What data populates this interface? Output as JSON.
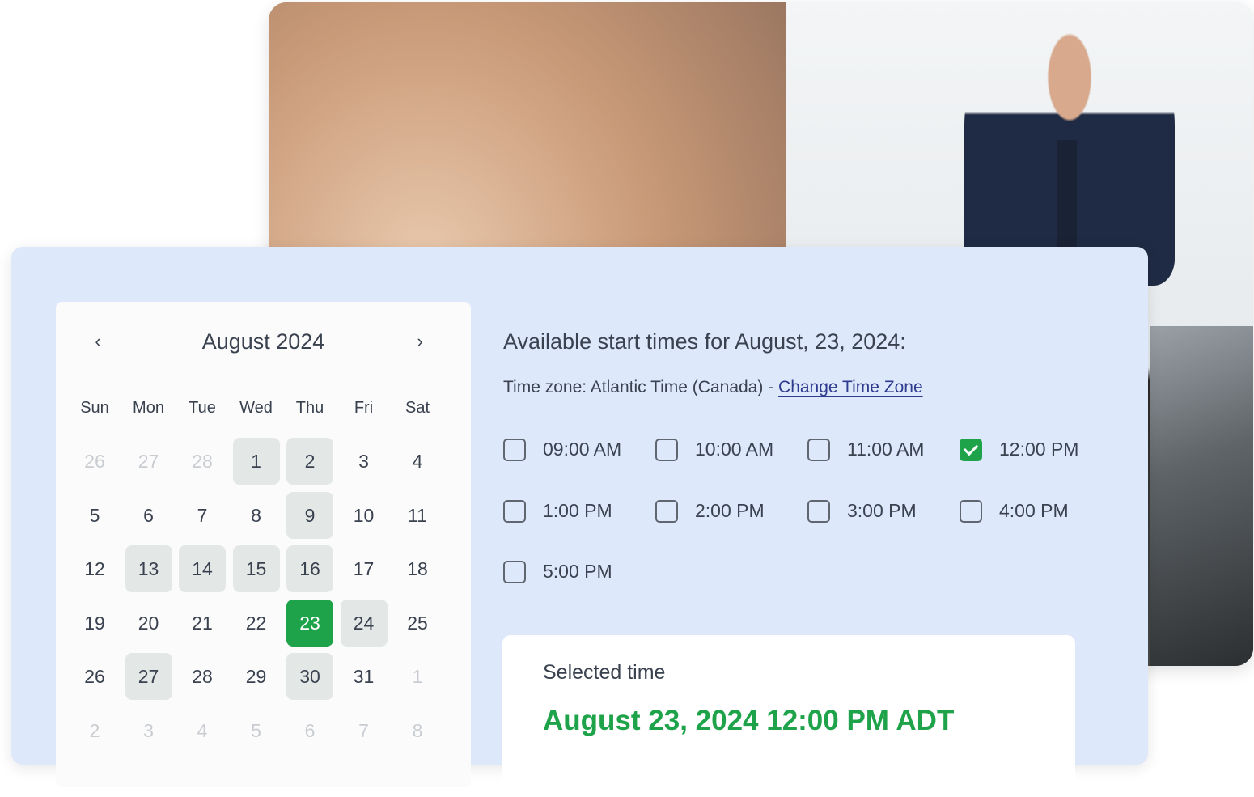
{
  "calendar": {
    "month_title": "August 2024",
    "prev_label": "‹",
    "next_label": "›",
    "weekdays": [
      "Sun",
      "Mon",
      "Tue",
      "Wed",
      "Thu",
      "Fri",
      "Sat"
    ],
    "weeks": [
      [
        {
          "d": "26",
          "s": "muted"
        },
        {
          "d": "27",
          "s": "muted"
        },
        {
          "d": "28",
          "s": "muted"
        },
        {
          "d": "1",
          "s": "avail"
        },
        {
          "d": "2",
          "s": "avail"
        },
        {
          "d": "3",
          "s": ""
        },
        {
          "d": "4",
          "s": ""
        }
      ],
      [
        {
          "d": "5",
          "s": ""
        },
        {
          "d": "6",
          "s": ""
        },
        {
          "d": "7",
          "s": ""
        },
        {
          "d": "8",
          "s": ""
        },
        {
          "d": "9",
          "s": "avail"
        },
        {
          "d": "10",
          "s": ""
        },
        {
          "d": "11",
          "s": ""
        }
      ],
      [
        {
          "d": "12",
          "s": ""
        },
        {
          "d": "13",
          "s": "avail"
        },
        {
          "d": "14",
          "s": "avail"
        },
        {
          "d": "15",
          "s": "avail"
        },
        {
          "d": "16",
          "s": "avail"
        },
        {
          "d": "17",
          "s": ""
        },
        {
          "d": "18",
          "s": ""
        }
      ],
      [
        {
          "d": "19",
          "s": ""
        },
        {
          "d": "20",
          "s": ""
        },
        {
          "d": "21",
          "s": ""
        },
        {
          "d": "22",
          "s": ""
        },
        {
          "d": "23",
          "s": "selected"
        },
        {
          "d": "24",
          "s": "avail"
        },
        {
          "d": "25",
          "s": ""
        }
      ],
      [
        {
          "d": "26",
          "s": ""
        },
        {
          "d": "27",
          "s": "avail"
        },
        {
          "d": "28",
          "s": ""
        },
        {
          "d": "29",
          "s": ""
        },
        {
          "d": "30",
          "s": "avail"
        },
        {
          "d": "31",
          "s": ""
        },
        {
          "d": "1",
          "s": "muted"
        }
      ],
      [
        {
          "d": "2",
          "s": "muted"
        },
        {
          "d": "3",
          "s": "muted"
        },
        {
          "d": "4",
          "s": "muted"
        },
        {
          "d": "5",
          "s": "muted"
        },
        {
          "d": "6",
          "s": "muted"
        },
        {
          "d": "7",
          "s": "muted"
        },
        {
          "d": "8",
          "s": "muted"
        }
      ]
    ]
  },
  "times": {
    "title": "Available start times for August, 23, 2024:",
    "timezone_prefix": "Time zone: Atlantic Time (Canada) - ",
    "timezone_link": "Change Time Zone",
    "slots": [
      {
        "label": "09:00 AM",
        "checked": false
      },
      {
        "label": "10:00 AM",
        "checked": false
      },
      {
        "label": "11:00 AM",
        "checked": false
      },
      {
        "label": "12:00 PM",
        "checked": true
      },
      {
        "label": "1:00 PM",
        "checked": false
      },
      {
        "label": "2:00 PM",
        "checked": false
      },
      {
        "label": "3:00 PM",
        "checked": false
      },
      {
        "label": "4:00 PM",
        "checked": false
      },
      {
        "label": "5:00 PM",
        "checked": false
      }
    ]
  },
  "selection": {
    "label": "Selected time",
    "value": "August 23, 2024 12:00 PM ADT"
  },
  "colors": {
    "accent_green": "#1fa34a",
    "panel_bg": "#dde8fb",
    "link": "#2f3b8f"
  }
}
